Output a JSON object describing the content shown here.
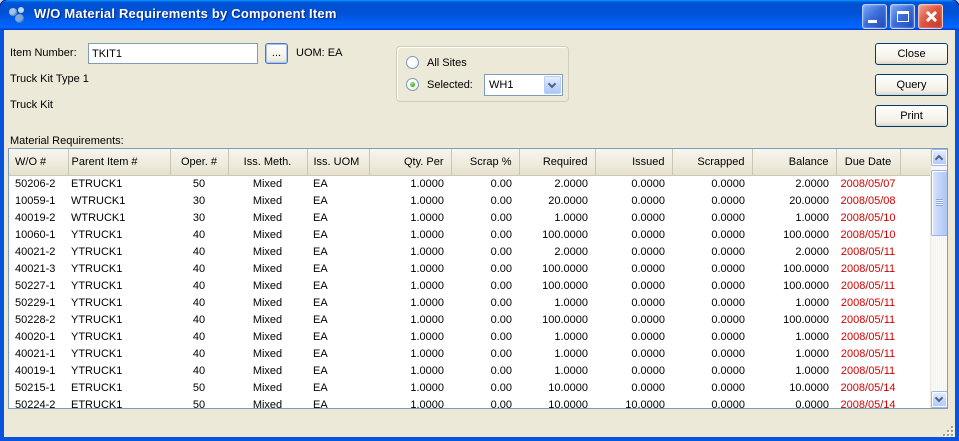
{
  "window": {
    "title": "W/O Material Requirements by Component Item"
  },
  "form": {
    "item_number_label": "Item Number:",
    "item_number_value": "TKIT1",
    "browse_label": "...",
    "uom_label": "UOM: EA",
    "description_line1": "Truck Kit Type 1",
    "description_line2": "Truck Kit",
    "sites": {
      "all_sites_label": "All Sites",
      "all_sites_checked": false,
      "selected_label": "Selected:",
      "selected_checked": true,
      "selected_site_value": "WH1"
    }
  },
  "actions": {
    "close_label": "Close",
    "query_label": "Query",
    "print_label": "Print"
  },
  "table": {
    "caption": "Material Requirements:",
    "columns": [
      "W/O #",
      "Parent Item #",
      "Oper. #",
      "Iss. Meth.",
      "Iss. UOM",
      "Qty. Per",
      "Scrap %",
      "Required",
      "Issued",
      "Scrapped",
      "Balance",
      "Due Date"
    ],
    "rows": [
      [
        "50206-2",
        "ETRUCK1",
        "50",
        "Mixed",
        "EA",
        "1.0000",
        "0.00",
        "2.0000",
        "0.0000",
        "0.0000",
        "2.0000",
        "2008/05/07"
      ],
      [
        "10059-1",
        "WTRUCK1",
        "30",
        "Mixed",
        "EA",
        "1.0000",
        "0.00",
        "20.0000",
        "0.0000",
        "0.0000",
        "20.0000",
        "2008/05/08"
      ],
      [
        "40019-2",
        "WTRUCK1",
        "30",
        "Mixed",
        "EA",
        "1.0000",
        "0.00",
        "1.0000",
        "0.0000",
        "0.0000",
        "1.0000",
        "2008/05/10"
      ],
      [
        "10060-1",
        "YTRUCK1",
        "40",
        "Mixed",
        "EA",
        "1.0000",
        "0.00",
        "100.0000",
        "0.0000",
        "0.0000",
        "100.0000",
        "2008/05/10"
      ],
      [
        "40021-2",
        "YTRUCK1",
        "40",
        "Mixed",
        "EA",
        "1.0000",
        "0.00",
        "2.0000",
        "0.0000",
        "0.0000",
        "2.0000",
        "2008/05/11"
      ],
      [
        "40021-3",
        "YTRUCK1",
        "40",
        "Mixed",
        "EA",
        "1.0000",
        "0.00",
        "100.0000",
        "0.0000",
        "0.0000",
        "100.0000",
        "2008/05/11"
      ],
      [
        "50227-1",
        "YTRUCK1",
        "40",
        "Mixed",
        "EA",
        "1.0000",
        "0.00",
        "100.0000",
        "0.0000",
        "0.0000",
        "100.0000",
        "2008/05/11"
      ],
      [
        "50229-1",
        "YTRUCK1",
        "40",
        "Mixed",
        "EA",
        "1.0000",
        "0.00",
        "1.0000",
        "0.0000",
        "0.0000",
        "1.0000",
        "2008/05/11"
      ],
      [
        "50228-2",
        "YTRUCK1",
        "40",
        "Mixed",
        "EA",
        "1.0000",
        "0.00",
        "100.0000",
        "0.0000",
        "0.0000",
        "100.0000",
        "2008/05/11"
      ],
      [
        "40020-1",
        "YTRUCK1",
        "40",
        "Mixed",
        "EA",
        "1.0000",
        "0.00",
        "1.0000",
        "0.0000",
        "0.0000",
        "1.0000",
        "2008/05/11"
      ],
      [
        "40021-1",
        "YTRUCK1",
        "40",
        "Mixed",
        "EA",
        "1.0000",
        "0.00",
        "1.0000",
        "0.0000",
        "0.0000",
        "1.0000",
        "2008/05/11"
      ],
      [
        "40019-1",
        "YTRUCK1",
        "40",
        "Mixed",
        "EA",
        "1.0000",
        "0.00",
        "1.0000",
        "0.0000",
        "0.0000",
        "1.0000",
        "2008/05/11"
      ],
      [
        "50215-1",
        "ETRUCK1",
        "50",
        "Mixed",
        "EA",
        "1.0000",
        "0.00",
        "10.0000",
        "0.0000",
        "0.0000",
        "10.0000",
        "2008/05/14"
      ],
      [
        "50224-2",
        "ETRUCK1",
        "50",
        "Mixed",
        "EA",
        "1.0000",
        "0.00",
        "10.0000",
        "10.0000",
        "0.0000",
        "0.0000",
        "2008/05/14"
      ]
    ]
  },
  "colors": {
    "due_date_red": "#d40000",
    "titlebar_blue": "#0058e6",
    "window_background": "#ece9d8",
    "radio_selected_green": "#2da012"
  }
}
